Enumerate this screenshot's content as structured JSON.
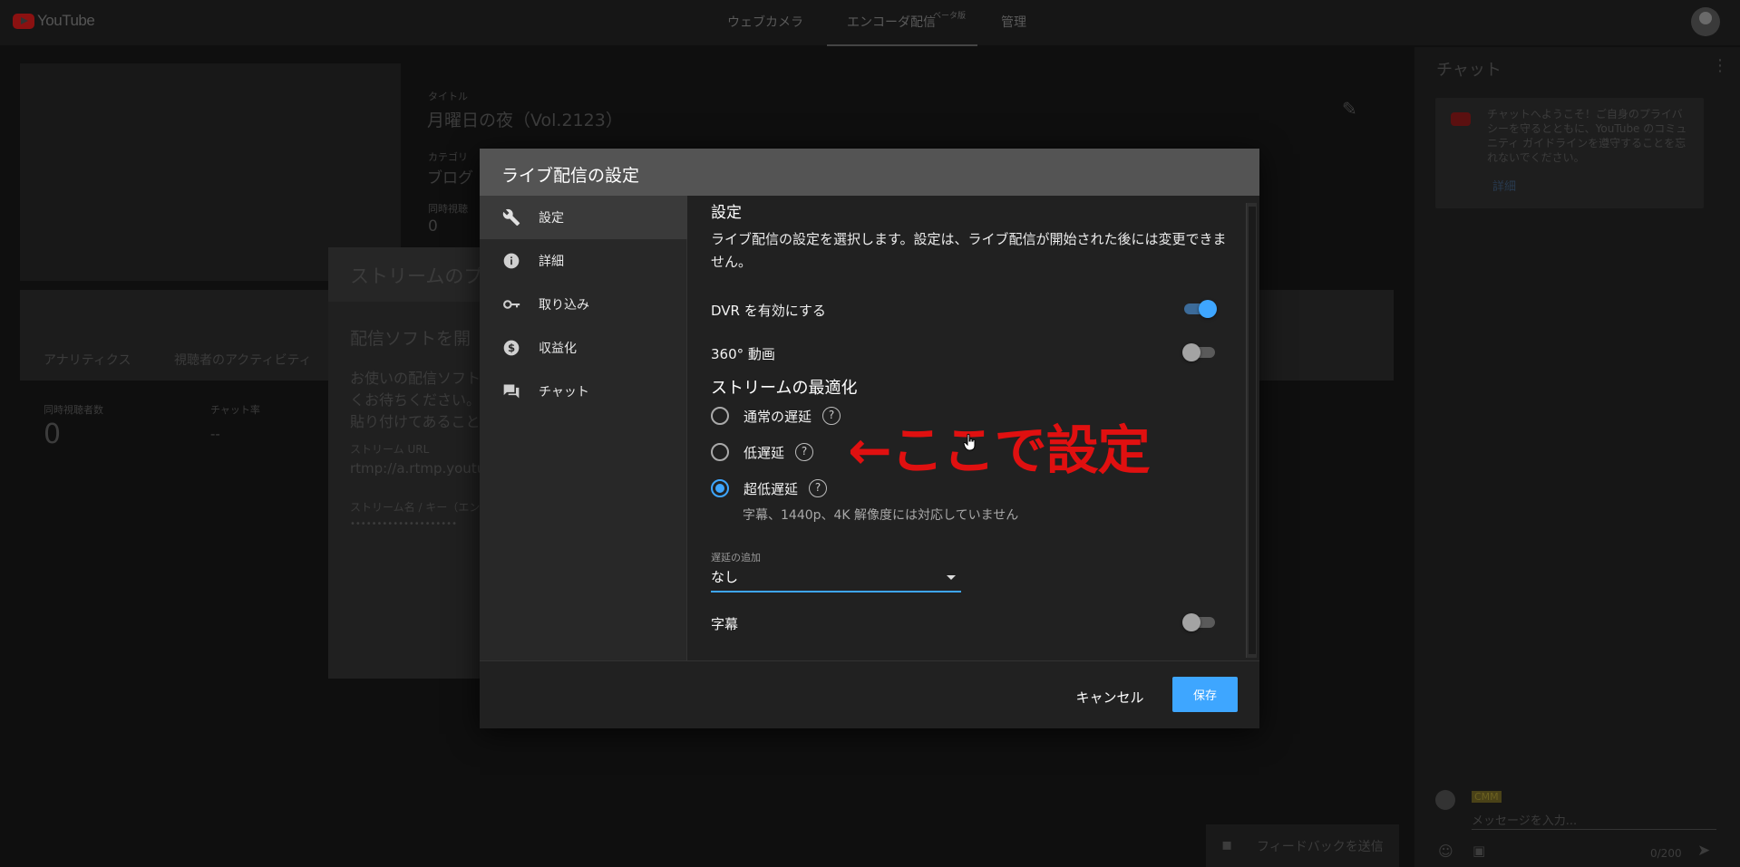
{
  "topbar": {
    "logo_text": "YouTube",
    "tabs": [
      "ウェブカメラ",
      "エンコーダ配信",
      "管理"
    ],
    "beta_badge": "ベータ版"
  },
  "background": {
    "title_label": "タイトル",
    "title_value": "月曜日の夜（Vol.2123）",
    "category_label": "カテゴリ",
    "category_value": "ブログ",
    "count_label": "同時視聴",
    "count_value": "0",
    "stream_panel_title": "ストリームのプ",
    "stream_heading": "配信ソフトを開",
    "stream_desc_1": "お使いの配信ソフト",
    "stream_desc_2": "くお待ちください。",
    "stream_desc_3": "貼り付けてあること",
    "stream_url_label": "ストリーム URL",
    "stream_url_value": "rtmp://a.rtmp.youtu",
    "stream_key_label": "ストリーム名 / キー（エン",
    "stream_key_value": "••••••••••••••••••••",
    "tab_analytics": "アナリティクス",
    "tab_activity": "視聴者のアクティビティ",
    "stat_viewers_label": "同時視聴者数",
    "stat_viewers_value": "0",
    "stat_chat_label": "チャット率",
    "stat_chat_value": "--"
  },
  "chat": {
    "title": "チャット",
    "welcome": "チャットへようこそ！ご自身のプライバシーを守るとともに、YouTube のコミュニティ ガイドラインを遵守することを忘れないでください。",
    "welcome_link": "詳細",
    "user_badge": "CMM",
    "input_placeholder": "メッセージを入力...",
    "char_count": "0/200"
  },
  "feedback_label": "フィードバックを送信",
  "modal": {
    "title": "ライブ配信の設定",
    "nav": [
      {
        "label": "設定",
        "icon": "wrench-icon"
      },
      {
        "label": "詳細",
        "icon": "info-icon"
      },
      {
        "label": "取り込み",
        "icon": "key-icon"
      },
      {
        "label": "収益化",
        "icon": "dollar-icon"
      },
      {
        "label": "チャット",
        "icon": "chat-icon"
      }
    ],
    "settings_title": "設定",
    "settings_desc": "ライブ配信の設定を選択します。設定は、ライブ配信が開始された後には変更できません。",
    "dvr_label": "DVR を有効にする",
    "dvr_enabled": true,
    "video360_label": "360° 動画",
    "video360_enabled": false,
    "optimization_title": "ストリームの最適化",
    "latency_options": [
      {
        "label": "通常の遅延",
        "checked": false
      },
      {
        "label": "低遅延",
        "checked": false
      },
      {
        "label": "超低遅延",
        "checked": true
      }
    ],
    "latency_note": "字幕、1440p、4K 解像度には対応していません",
    "delay_label": "遅延の追加",
    "delay_value": "なし",
    "captions_label": "字幕",
    "captions_enabled": false,
    "cancel_label": "キャンセル",
    "save_label": "保存"
  },
  "annotation_text": "←ここで設定",
  "colors": {
    "accent": "#3ea6ff",
    "annotation": "#e01010",
    "modal_header": "#545454"
  }
}
